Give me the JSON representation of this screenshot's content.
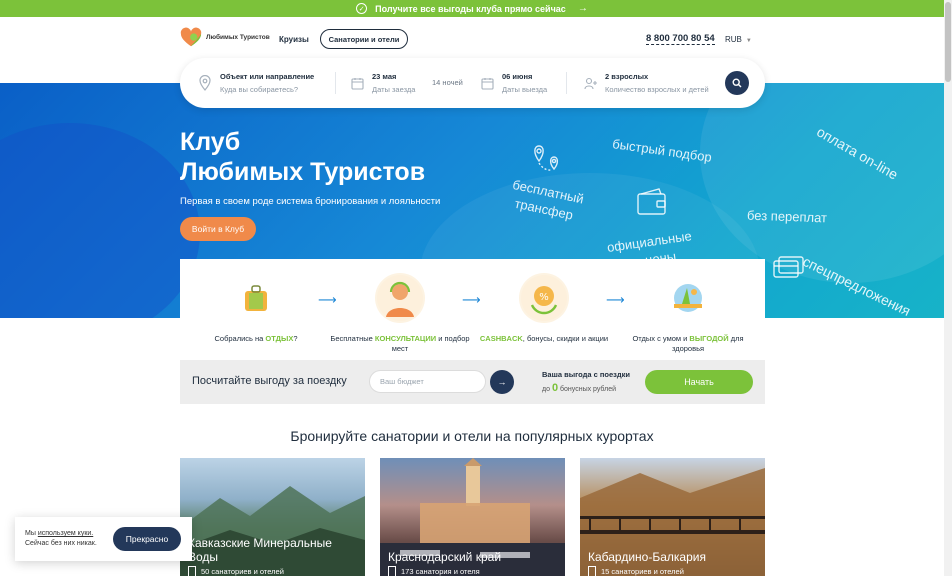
{
  "promo": {
    "text": "Получите все выгоды клуба прямо сейчас",
    "arrow": "→"
  },
  "header": {
    "logo_name_line1": "Любимых Туристов",
    "nav_cruises": "Круизы",
    "nav_sanatoriums": "Санатории и отели",
    "phone": "8 800 700 80 54",
    "currency": "RUB"
  },
  "search": {
    "destination_label": "Объект или направление",
    "destination_placeholder": "Куда вы собираетесь?",
    "checkin_value": "23 мая",
    "checkin_label": "Даты заезда",
    "nights": "14 ночей",
    "checkout_value": "06 июня",
    "checkout_label": "Даты выезда",
    "guests_value": "2 взрослых",
    "guests_label": "Количество взрослых и детей"
  },
  "hero": {
    "title_line1": "Клуб",
    "title_line2": "Любимых Туристов",
    "subtitle": "Первая в своем роде система бронирования и лояльности",
    "cta": "Войти в Клуб",
    "words": {
      "fast": "быстрый подбор",
      "transfer_line1": "бесплатный",
      "transfer_line2": "трансфер",
      "online": "оплата on-line",
      "nofees": "без переплат",
      "official_line1": "официальные",
      "official_line2": "цены",
      "special": "спецпредложения"
    }
  },
  "steps": [
    {
      "pre": "Собрались на ",
      "hl": "ОТДЫХ",
      "post": "?"
    },
    {
      "pre": "Бесплатные ",
      "hl": "КОНСУЛЬТАЦИИ",
      "post": " и подбор мест"
    },
    {
      "pre": "",
      "hl": "CASHBACK",
      "post": ", бонусы, скидки и акции"
    },
    {
      "pre": "Отдых с умом и ",
      "hl": "ВЫГОДОЙ",
      "post": " для здоровья"
    }
  ],
  "calc": {
    "title": "Посчитайте выгоду за поездку",
    "budget_placeholder": "Ваш бюджет",
    "benefit_title": "Ваша выгода с поездки",
    "benefit_pre": "до ",
    "benefit_value": "0",
    "benefit_post": " бонусных рублей",
    "start": "Начать"
  },
  "resorts": {
    "title": "Бронируйте санатории и отели на популярных курортах",
    "cards": [
      {
        "name_line1": "Кавказские Минеральные",
        "name_line2": "Воды",
        "count": "50 санаториев и отелей"
      },
      {
        "name_line1": "Краснодарский край",
        "name_line2": "",
        "count": "173 санатория и отеля"
      },
      {
        "name_line1": "Кабардино-Балкария",
        "name_line2": "",
        "count": "15 санаториев и отелей"
      }
    ]
  },
  "cookie": {
    "pre": "Мы ",
    "link": "используем куки.",
    "line2": "Сейчас без них никак.",
    "ok": "Прекрасно"
  },
  "colors": {
    "green": "#7cc23a",
    "navy": "#23385a",
    "orange": "#f08a4a",
    "blue": "#1688d6"
  }
}
